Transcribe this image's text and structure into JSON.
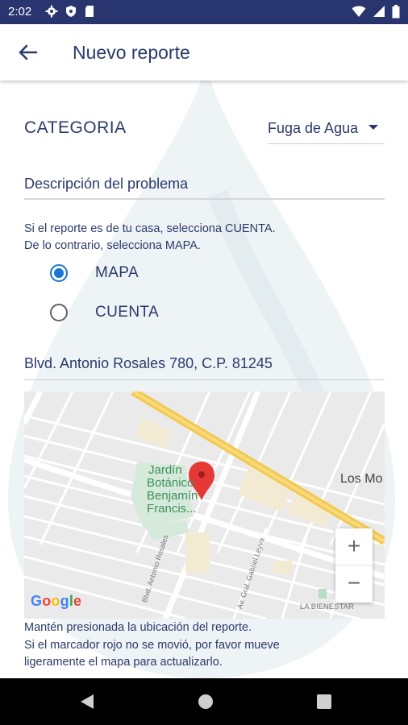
{
  "status_bar": {
    "time": "2:02",
    "left_icons": [
      "gear-icon",
      "shield-icon",
      "sd-card-icon"
    ],
    "right_icons": [
      "wifi-icon",
      "signal-icon",
      "battery-icon"
    ]
  },
  "app_bar": {
    "back_icon": "arrow-left-icon",
    "title": "Nuevo reporte"
  },
  "form": {
    "category_label": "CATEGORIA",
    "category_value": "Fuga de Agua",
    "description_placeholder": "Descripción del problema",
    "help_line_1": "Si el reporte es de tu casa, selecciona CUENTA.",
    "help_line_2": "De lo contrario, selecciona MAPA.",
    "location_options": [
      {
        "label": "MAPA",
        "selected": true
      },
      {
        "label": "CUENTA",
        "selected": false
      }
    ],
    "address_value": "Blvd. Antonio Rosales 780, C.P. 81245"
  },
  "map": {
    "poi_line_1": "Jardín",
    "poi_line_2": "Botánico",
    "poi_line_3": "Benjamín",
    "poi_line_4": "Francis...",
    "place_label": "Los Mo",
    "street_1": "Blvd. Antonio Rosales",
    "street_2": "Av. Gral. Gabriel Leyva",
    "area_label": "LA BIENESTAR",
    "zoom_in": "+",
    "zoom_out": "−",
    "attribution": "Google",
    "marker_color": "#e53935"
  },
  "hint": {
    "line_1": "Mantén presionada la ubicación del reporte.",
    "line_2": "Si el marcador rojo no se movió, por favor mueve",
    "line_3": "ligeramente el mapa para actualizarlo."
  },
  "nav_bar": {
    "buttons": [
      "back-triangle-icon",
      "home-circle-icon",
      "recents-square-icon"
    ]
  },
  "colors": {
    "status_bar": "#28356e",
    "text_primary": "#2b3a6b",
    "radio_selected": "#1976d2"
  }
}
